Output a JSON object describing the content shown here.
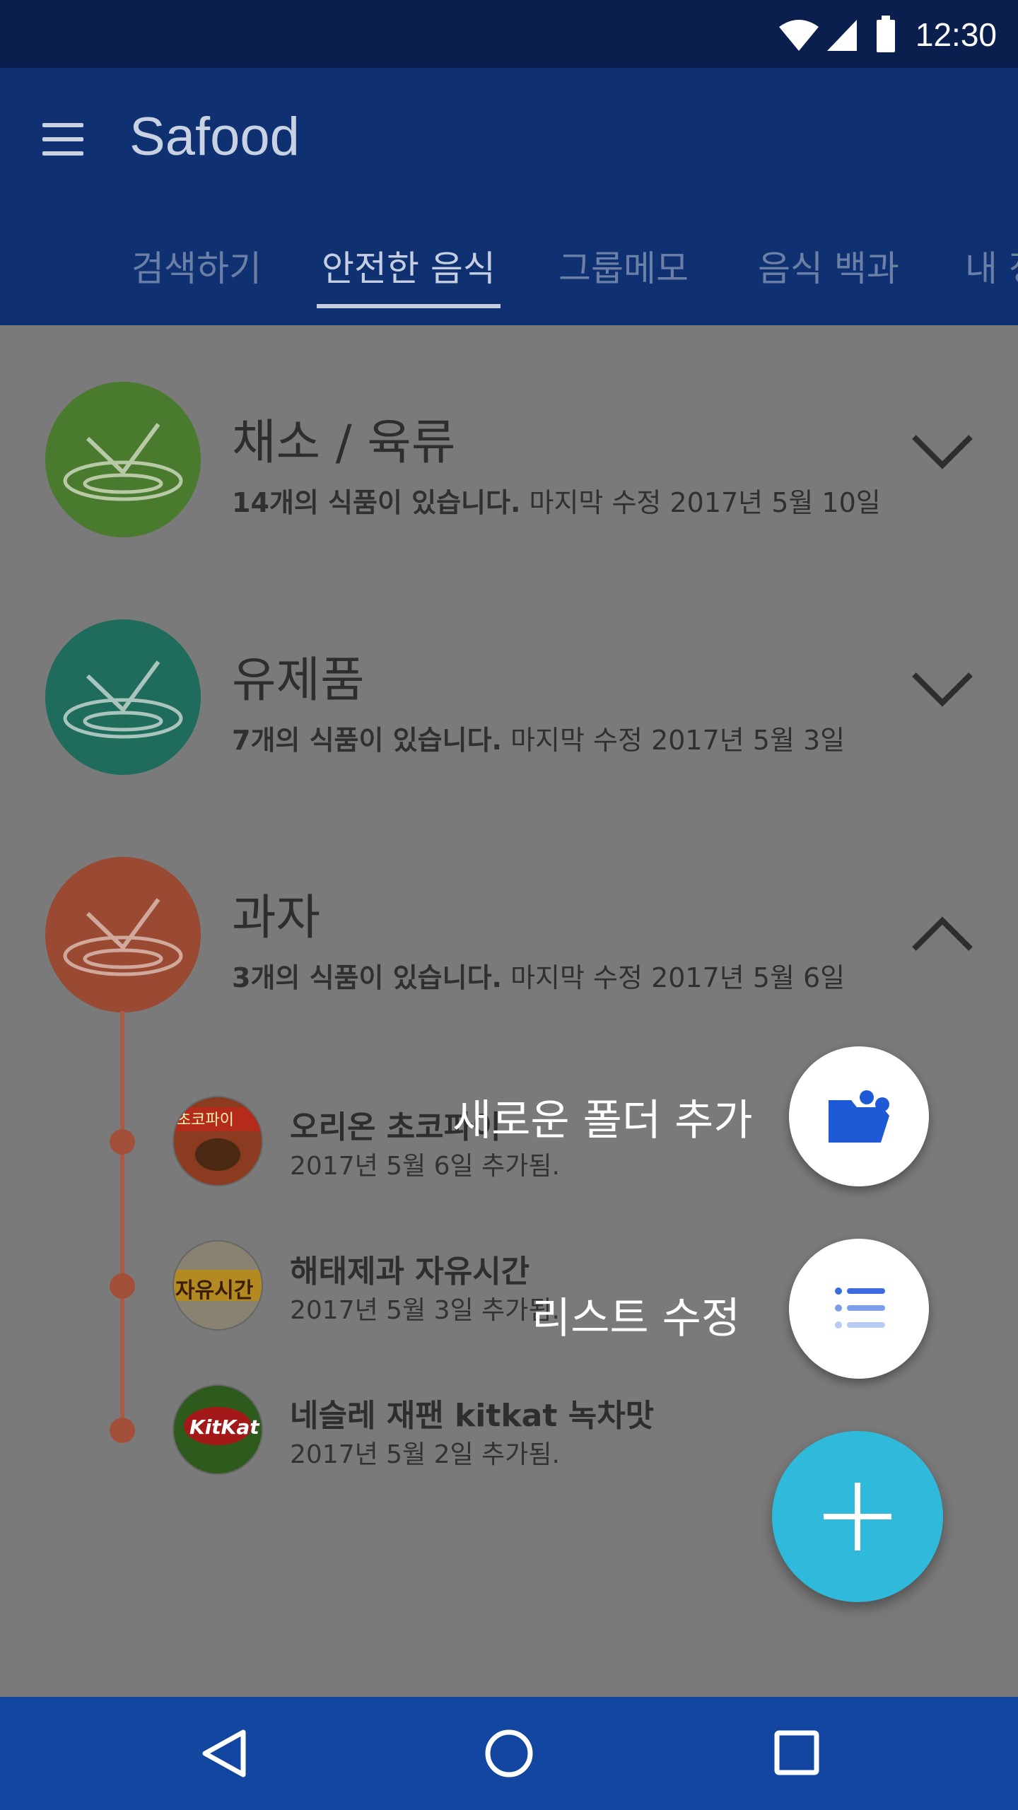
{
  "status_bar": {
    "time": "12:30"
  },
  "app_bar": {
    "title": "Safood"
  },
  "tabs": [
    {
      "label": "검색하기",
      "active": false
    },
    {
      "label": "안전한 음식",
      "active": true
    },
    {
      "label": "그룹메모",
      "active": false
    },
    {
      "label": "음식 백과",
      "active": false
    },
    {
      "label": "내 정",
      "active": false
    }
  ],
  "folders": [
    {
      "title": "채소 / 육류",
      "count_text": "14개의 식품이 있습니다.",
      "modified_text": "마지막 수정 2017년 5월 10일",
      "color": "#4a7a2e",
      "expanded": false
    },
    {
      "title": "유제품",
      "count_text": "7개의 식품이 있습니다.",
      "modified_text": "마지막 수정 2017년 5월 3일",
      "color": "#1f6b5c",
      "expanded": false
    },
    {
      "title": "과자",
      "count_text": "3개의 식품이 있습니다.",
      "modified_text": "마지막 수정 2017년 5월 6일",
      "color": "#9a4a33",
      "expanded": true
    }
  ],
  "items": [
    {
      "name": "오리온 초코파이",
      "added": "2017년 5월 6일 추가됨.",
      "thumb_text": "초코파이"
    },
    {
      "name": "해태제과 자유시간",
      "added": "2017년 5월 3일 추가됨.",
      "thumb_text": "자유시간"
    },
    {
      "name": "네슬레 재팬 kitkat 녹차맛",
      "added": "2017년 5월 2일 추가됨.",
      "thumb_text": "KitKat"
    }
  ],
  "fab_menu": {
    "new_folder_label": "새로운 폴더 추가",
    "edit_list_label": "리스트 수정"
  },
  "colors": {
    "accent": "#2fb9db",
    "primary": "#1346a0",
    "scrim": "#7a7a7a"
  }
}
